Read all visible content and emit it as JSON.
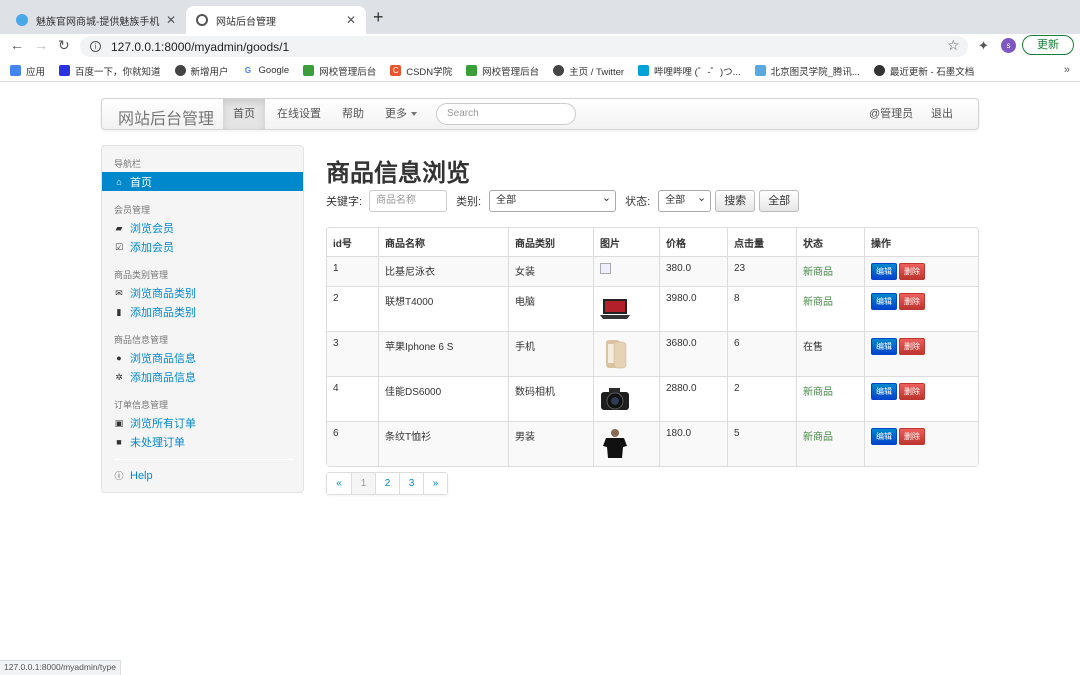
{
  "browser": {
    "tabs": [
      {
        "title": "魅族官网商城-提供魅族手机 PRO"
      },
      {
        "title": "网站后台管理"
      }
    ],
    "url": "127.0.0.1:8000/myadmin/goods/1",
    "update_label": "更新",
    "profile_initial": "s",
    "bookmarks": [
      "应用",
      "百度一下，你就知道",
      "新增用户",
      "Google",
      "网校管理后台",
      "CSDN学院",
      "网校管理后台",
      "主页 / Twitter",
      "哔哩哔哩 (゜-゜)つ...",
      "北京图灵学院_腾讯...",
      "最近更新 - 石墨文档"
    ],
    "more": "»",
    "status_url": "127.0.0.1:8000/myadmin/type"
  },
  "navbar": {
    "brand": "网站后台管理",
    "items": [
      "首页",
      "在线设置",
      "帮助",
      "更多"
    ],
    "search_placeholder": "Search",
    "user": "@管理员",
    "logout": "退出"
  },
  "sidebar": {
    "header": "导航栏",
    "home": "首页",
    "groups": [
      {
        "title": "会员管理",
        "items": [
          "浏览会员",
          "添加会员"
        ]
      },
      {
        "title": "商品类别管理",
        "items": [
          "浏览商品类别",
          "添加商品类别"
        ]
      },
      {
        "title": "商品信息管理",
        "items": [
          "浏览商品信息",
          "添加商品信息"
        ]
      },
      {
        "title": "订单信息管理",
        "items": [
          "浏览所有订单",
          "未处理订单"
        ]
      }
    ],
    "help": "Help"
  },
  "page": {
    "title": "商品信息浏览",
    "filter": {
      "keyword_label": "关键字:",
      "keyword_placeholder": "商品名称",
      "category_label": "类别:",
      "category_value": "全部",
      "status_label": "状态:",
      "status_value": "全部",
      "search_button": "搜索",
      "all_button": "全部"
    },
    "table": {
      "headers": [
        "id号",
        "商品名称",
        "商品类别",
        "图片",
        "价格",
        "点击量",
        "状态",
        "操作"
      ],
      "rows": [
        {
          "id": "1",
          "name": "比基尼泳衣",
          "category": "女装",
          "price": "380.0",
          "clicks": "23",
          "status": "新商品",
          "image": "broken"
        },
        {
          "id": "2",
          "name": "联想T4000",
          "category": "电脑",
          "price": "3980.0",
          "clicks": "8",
          "status": "新商品",
          "image": "laptop"
        },
        {
          "id": "3",
          "name": "苹果Iphone 6 S",
          "category": "手机",
          "price": "3680.0",
          "clicks": "6",
          "status": "在售",
          "image": "phone"
        },
        {
          "id": "4",
          "name": "佳能DS6000",
          "category": "数码相机",
          "price": "2880.0",
          "clicks": "2",
          "status": "新商品",
          "image": "camera"
        },
        {
          "id": "6",
          "name": "条纹T恤衫",
          "category": "男装",
          "price": "180.0",
          "clicks": "5",
          "status": "新商品",
          "image": "tshirt"
        }
      ],
      "edit_label": "编辑",
      "delete_label": "删除"
    },
    "pagination": [
      "«",
      "1",
      "2",
      "3",
      "»"
    ]
  }
}
